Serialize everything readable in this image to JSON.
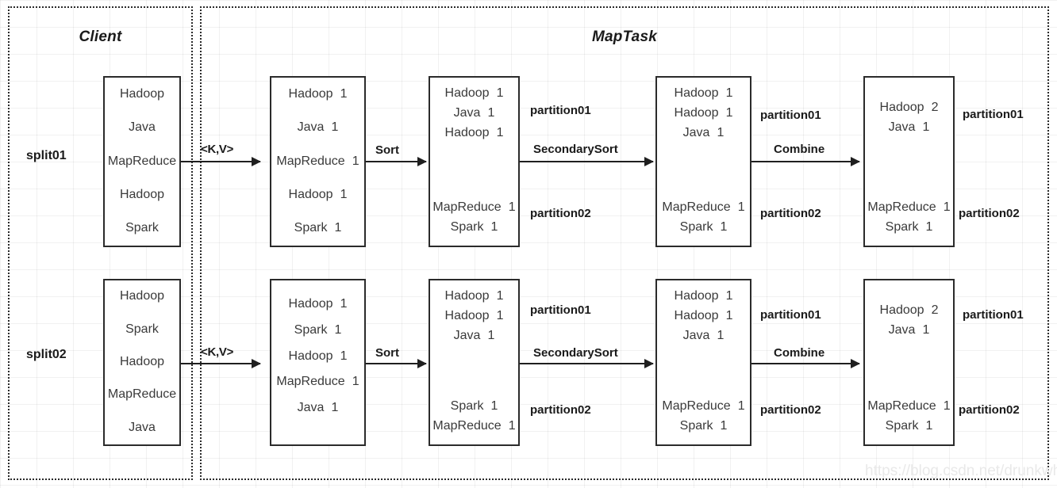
{
  "regions": [
    {
      "title": "Client"
    },
    {
      "title": "MapTask"
    }
  ],
  "splits": [
    {
      "label": "split01"
    },
    {
      "label": "split02"
    }
  ],
  "edge_labels": {
    "kv": "<K,V>",
    "sort": "Sort",
    "secondary_sort": "SecondarySort",
    "combine": "Combine",
    "partition01": "partition01",
    "partition02": "partition02"
  },
  "watermark": "https://blog.csdn.net/drunkwhisky",
  "rows": [
    {
      "name": "split01",
      "input_box": {
        "lines": [
          {
            "term": "Hadoop",
            "count": ""
          },
          {
            "term": "Java",
            "count": ""
          },
          {
            "term": "MapReduce",
            "count": ""
          },
          {
            "term": "Hadoop",
            "count": ""
          },
          {
            "term": "Spark",
            "count": ""
          }
        ]
      },
      "mapped_box": {
        "lines": [
          {
            "term": "Hadoop",
            "count": "1"
          },
          {
            "term": "Java",
            "count": "1"
          },
          {
            "term": "MapReduce",
            "count": "1"
          },
          {
            "term": "Hadoop",
            "count": "1"
          },
          {
            "term": "Spark",
            "count": "1"
          }
        ]
      },
      "sorted_box": {
        "partition01": [
          {
            "term": "Hadoop",
            "count": "1"
          },
          {
            "term": "Java",
            "count": "1"
          },
          {
            "term": "Hadoop",
            "count": "1"
          }
        ],
        "partition02": [
          {
            "term": "MapReduce",
            "count": "1"
          },
          {
            "term": "Spark",
            "count": "1"
          }
        ]
      },
      "secondary_sorted_box": {
        "partition01": [
          {
            "term": "Hadoop",
            "count": "1"
          },
          {
            "term": "Hadoop",
            "count": "1"
          },
          {
            "term": "Java",
            "count": "1"
          }
        ],
        "partition02": [
          {
            "term": "MapReduce",
            "count": "1"
          },
          {
            "term": "Spark",
            "count": "1"
          }
        ]
      },
      "combined_box": {
        "partition01": [
          {
            "term": "Hadoop",
            "count": "2"
          },
          {
            "term": "Java",
            "count": "1"
          }
        ],
        "partition02": [
          {
            "term": "MapReduce",
            "count": "1"
          },
          {
            "term": "Spark",
            "count": "1"
          }
        ]
      }
    },
    {
      "name": "split02",
      "input_box": {
        "lines": [
          {
            "term": "Hadoop",
            "count": ""
          },
          {
            "term": "Spark",
            "count": ""
          },
          {
            "term": "Hadoop",
            "count": ""
          },
          {
            "term": "MapReduce",
            "count": ""
          },
          {
            "term": "Java",
            "count": ""
          }
        ]
      },
      "mapped_box": {
        "lines": [
          {
            "term": "Hadoop",
            "count": "1"
          },
          {
            "term": "Spark",
            "count": "1"
          },
          {
            "term": "Hadoop",
            "count": "1"
          },
          {
            "term": "MapReduce",
            "count": "1"
          },
          {
            "term": "Java",
            "count": "1"
          }
        ]
      },
      "sorted_box": {
        "partition01": [
          {
            "term": "Hadoop",
            "count": "1"
          },
          {
            "term": "Hadoop",
            "count": "1"
          },
          {
            "term": "Java",
            "count": "1"
          }
        ],
        "partition02": [
          {
            "term": "Spark",
            "count": "1"
          },
          {
            "term": "MapReduce",
            "count": "1"
          }
        ]
      },
      "secondary_sorted_box": {
        "partition01": [
          {
            "term": "Hadoop",
            "count": "1"
          },
          {
            "term": "Hadoop",
            "count": "1"
          },
          {
            "term": "Java",
            "count": "1"
          }
        ],
        "partition02": [
          {
            "term": "MapReduce",
            "count": "1"
          },
          {
            "term": "Spark",
            "count": "1"
          }
        ]
      },
      "combined_box": {
        "partition01": [
          {
            "term": "Hadoop",
            "count": "2"
          },
          {
            "term": "Java",
            "count": "1"
          }
        ],
        "partition02": [
          {
            "term": "MapReduce",
            "count": "1"
          },
          {
            "term": "Spark",
            "count": "1"
          }
        ]
      }
    }
  ]
}
